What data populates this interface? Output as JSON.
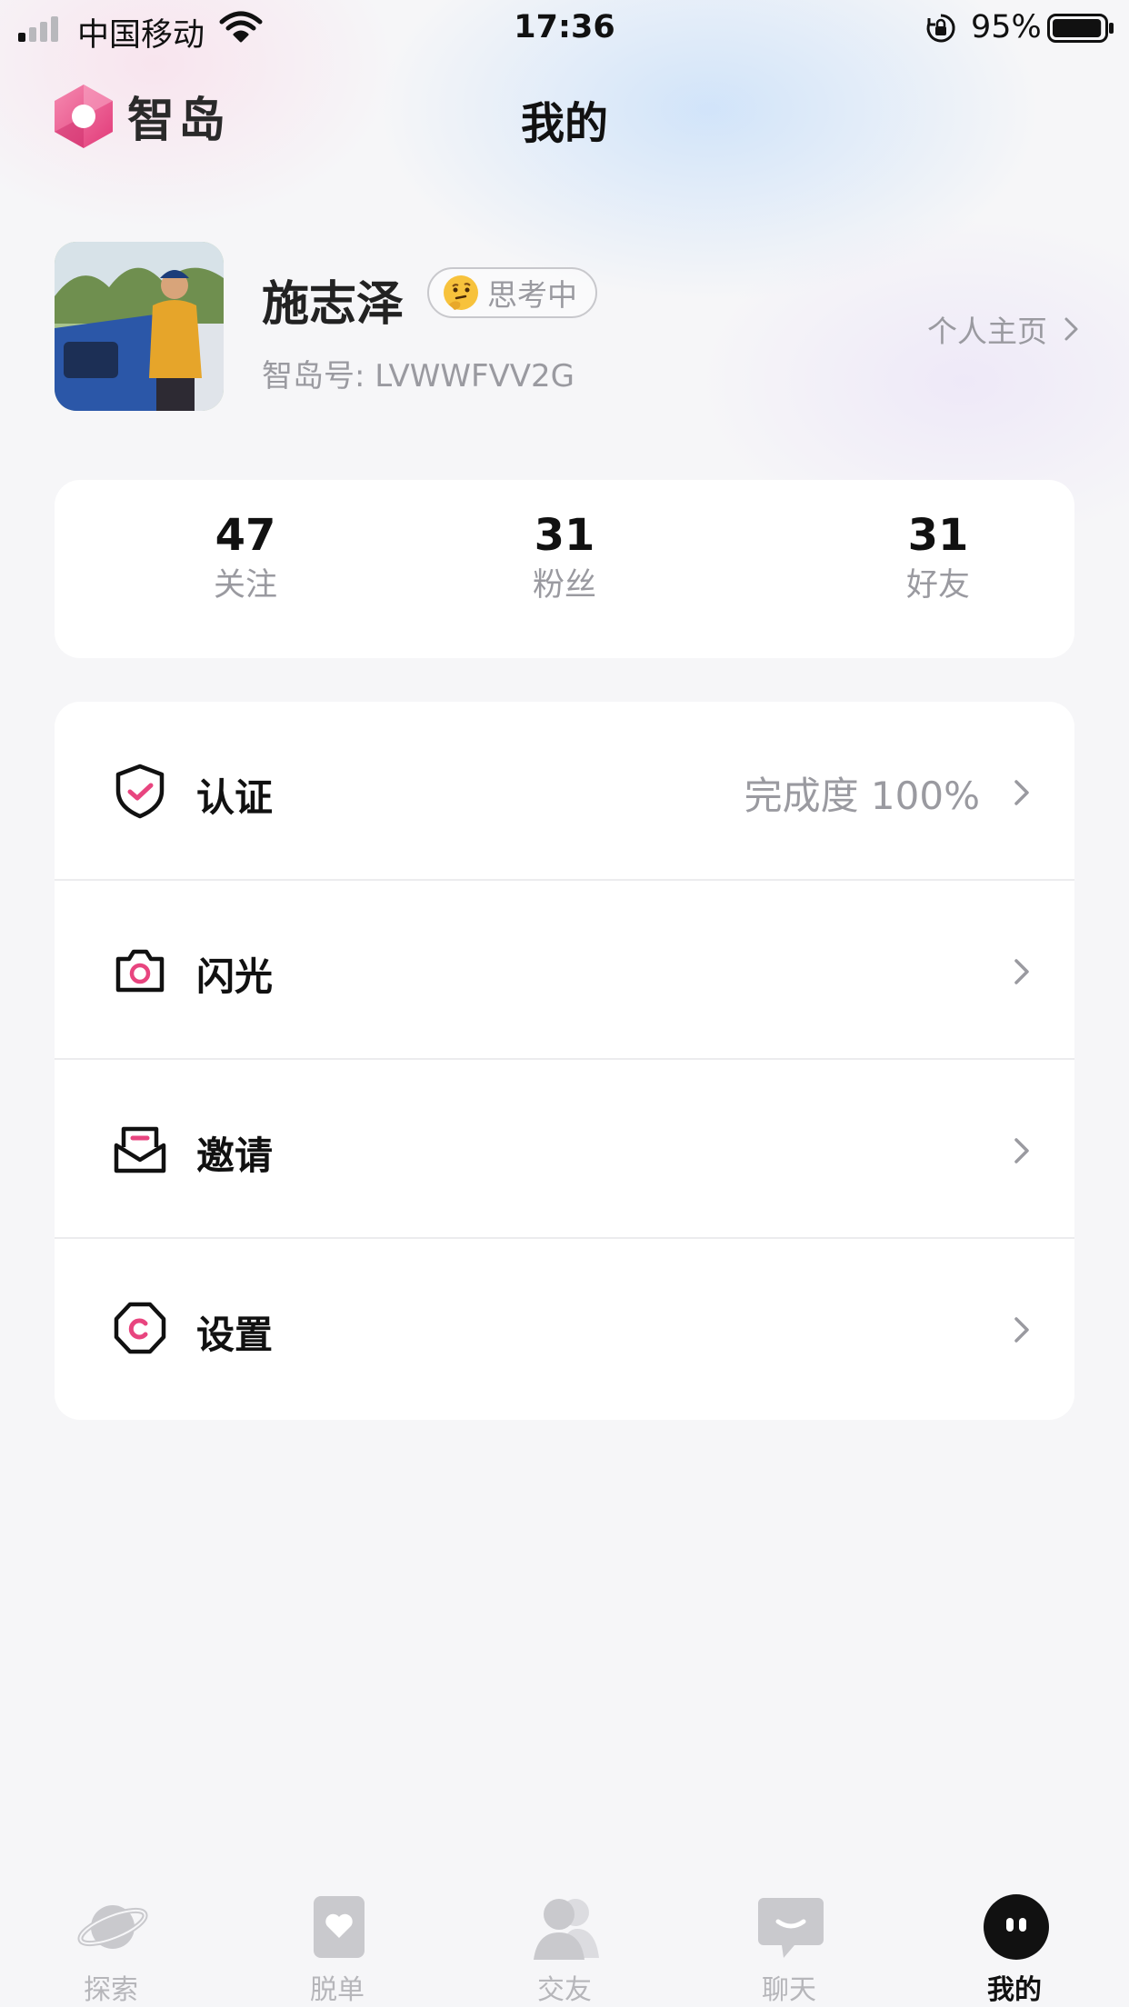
{
  "status_bar": {
    "carrier": "中国移动",
    "time": "17:36",
    "battery_percent": "95%",
    "battery_level": 0.95,
    "signal_bars_active": 1,
    "icons": [
      "signal-icon",
      "wifi-icon",
      "orientation-lock-icon",
      "battery-icon"
    ]
  },
  "header": {
    "logo_text": "智岛",
    "title": "我的"
  },
  "profile": {
    "name": "施志泽",
    "mood_badge": "思考中",
    "mood_emoji": "thinking-face-icon",
    "user_id_label": "智岛号: LVWWFVV2G",
    "homepage_link": "个人主页"
  },
  "stats": [
    {
      "value": "47",
      "label": "关注"
    },
    {
      "value": "31",
      "label": "粉丝"
    },
    {
      "value": "31",
      "label": "好友"
    }
  ],
  "menu": [
    {
      "icon": "shield-check-icon",
      "label": "认证",
      "value": "完成度 100%"
    },
    {
      "icon": "camera-icon",
      "label": "闪光",
      "value": ""
    },
    {
      "icon": "envelope-icon",
      "label": "邀请",
      "value": ""
    },
    {
      "icon": "settings-hexagon-icon",
      "label": "设置",
      "value": ""
    }
  ],
  "tab_bar": {
    "tabs": [
      {
        "label": "探索",
        "icon": "planet-icon",
        "active": false
      },
      {
        "label": "脱单",
        "icon": "heart-card-icon",
        "active": false
      },
      {
        "label": "交友",
        "icon": "friends-icon",
        "active": false
      },
      {
        "label": "聊天",
        "icon": "chat-bubble-icon",
        "active": false
      },
      {
        "label": "我的",
        "icon": "profile-face-icon",
        "active": true
      }
    ]
  },
  "colors": {
    "accent_pink": "#e8457f",
    "text_primary": "#111111",
    "text_secondary": "#9a9aa0",
    "tab_inactive": "#b6b6ba",
    "background": "#f6f6f8"
  }
}
